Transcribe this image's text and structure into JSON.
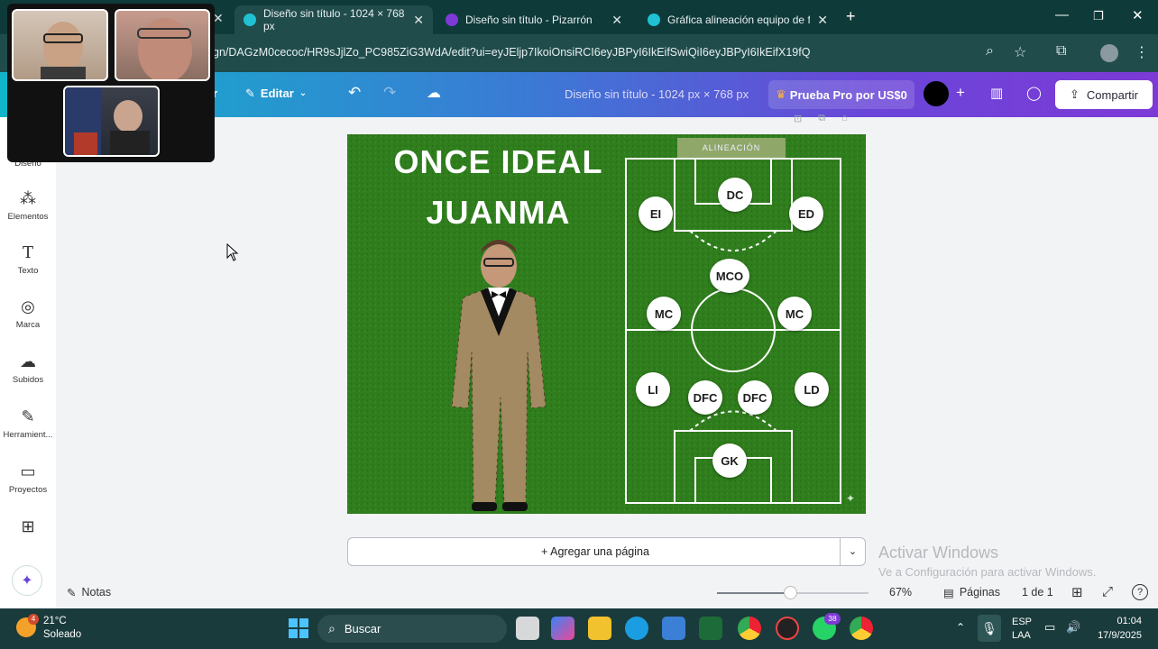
{
  "browser": {
    "tabs": [
      {
        "label": "Diseño sin título - 1024 × 768 px",
        "active": true
      },
      {
        "label": "Diseño sin título - Pizarrón",
        "active": false
      },
      {
        "label": "Gráfica alineación equipo de fu",
        "active": false
      }
    ],
    "new_tab": "+",
    "url": "gn/DAGzM0cecoc/HR9sJjlZo_PC985ZiG3WdA/edit?ui=eyJEljp7IkoiOnsiRCI6eyJBPyI6IkEifSwiQiI6eyJBPyI6IkEifX19fQ"
  },
  "toolbar": {
    "partial": "r",
    "edit_label": "Editar",
    "doc_title": "Diseño sin título - 1024 px × 768 px",
    "pro_label": "Prueba Pro por US$0",
    "share_label": "Compartir",
    "color_swatch": "#000000"
  },
  "sidebar": {
    "items": [
      {
        "label": "Diseño",
        "icon": "layout-icon"
      },
      {
        "label": "Elementos",
        "icon": "shapes-icon"
      },
      {
        "label": "Texto",
        "icon": "text-icon"
      },
      {
        "label": "Marca",
        "icon": "brand-icon"
      },
      {
        "label": "Subidos",
        "icon": "cloud-upload-icon"
      },
      {
        "label": "Herramient...",
        "icon": "pen-icon"
      },
      {
        "label": "Proyectos",
        "icon": "folder-icon"
      },
      {
        "label": "",
        "icon": "apps-icon"
      }
    ],
    "magic_icon": "sparkle-icon"
  },
  "design": {
    "title_line1": "ONCE IDEAL",
    "title_line2": "JUANMA",
    "badge": "ALINEACIÓN",
    "positions": [
      {
        "label": "DC"
      },
      {
        "label": "EI"
      },
      {
        "label": "ED"
      },
      {
        "label": "MCO"
      },
      {
        "label": "MC"
      },
      {
        "label": "MC"
      },
      {
        "label": "LI"
      },
      {
        "label": "DFC"
      },
      {
        "label": "DFC"
      },
      {
        "label": "LD"
      },
      {
        "label": "GK"
      }
    ],
    "background": "#2f7d1d"
  },
  "add_page": "+ Agregar una página",
  "watermark": {
    "line1": "Activar Windows",
    "line2": "Ve a Configuración para activar Windows."
  },
  "footer": {
    "notes": "Notas",
    "zoom": "67%",
    "pages_label": "Páginas",
    "page_count": "1 de 1"
  },
  "taskbar": {
    "weather_temp": "21°C",
    "weather_desc": "Soleado",
    "weather_badge": "4",
    "search": "Buscar",
    "whatsapp_badge": "38",
    "lang1": "ESP",
    "lang2": "LAA",
    "time": "01:04",
    "date": "17/9/2025"
  }
}
